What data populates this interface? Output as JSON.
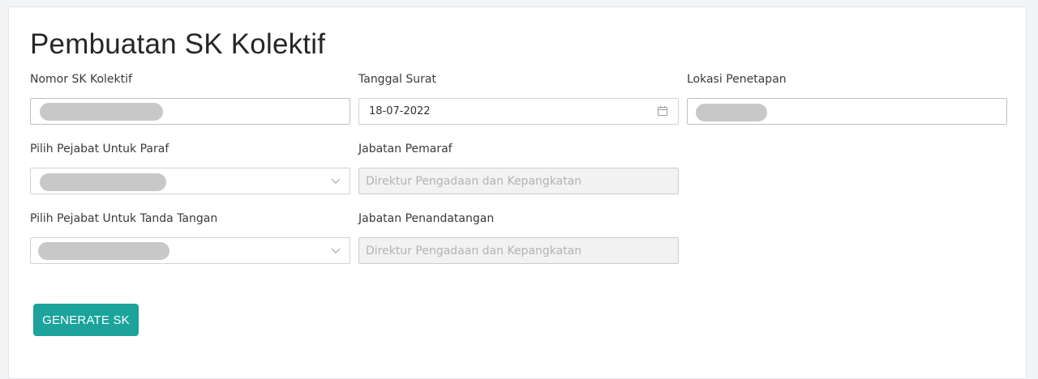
{
  "page": {
    "title": "Pembuatan SK Kolektif"
  },
  "form": {
    "nomor_sk": {
      "label": "Nomor SK Kolektif",
      "value": ""
    },
    "tanggal_surat": {
      "label": "Tanggal Surat",
      "value": "18-07-2022"
    },
    "lokasi_penetapan": {
      "label": "Lokasi Penetapan",
      "value": ""
    },
    "pejabat_paraf": {
      "label": "Pilih Pejabat Untuk Paraf",
      "value": ""
    },
    "jabatan_pemaraf": {
      "label": "Jabatan Pemaraf",
      "placeholder": "Direktur Pengadaan dan Kepangkatan"
    },
    "pejabat_ttd": {
      "label": "Pilih Pejabat Untuk Tanda Tangan",
      "value": ""
    },
    "jabatan_penandatangan": {
      "label": "Jabatan Penandatangan",
      "placeholder": "Direktur Pengadaan dan Kepangkatan"
    }
  },
  "actions": {
    "generate_label": "GENERATE SK"
  },
  "icons": {
    "calendar": "calendar-icon",
    "chevron": "chevron-down-icon"
  },
  "colors": {
    "accent": "#1ba39c"
  }
}
